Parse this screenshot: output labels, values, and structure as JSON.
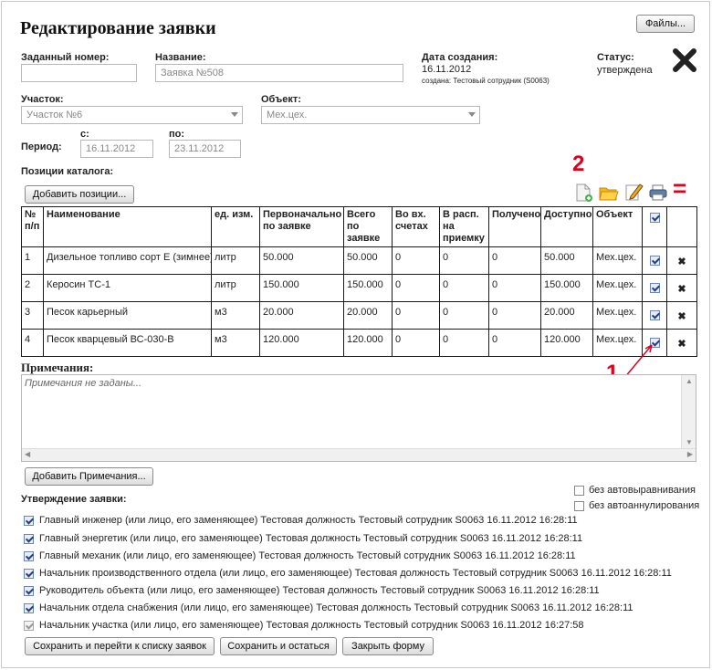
{
  "header": {
    "title": "Редактирование заявки",
    "files_button": "Файлы..."
  },
  "fields": {
    "number_label": "Заданный номер:",
    "number_value": "",
    "name_label": "Название:",
    "name_value": "Заявка №508",
    "created_label": "Дата создания:",
    "created_date": "16.11.2012",
    "created_by": "создана: Тестовый сотрудник (S0063)",
    "status_label": "Статус:",
    "status_value": "утверждена",
    "section_label": "Участок:",
    "section_value": "Участок №6",
    "object_label": "Объект:",
    "object_value": "Мех.цех.",
    "period_label": "Период:",
    "from_label": "с:",
    "from_value": "16.11.2012",
    "to_label": "по:",
    "to_value": "23.11.2012"
  },
  "catalog": {
    "label": "Позиции каталога:",
    "add_button": "Добавить позиции...",
    "toolbar_icons": [
      "new-document-icon",
      "folder-icon",
      "edit-pencil-icon",
      "print-icon"
    ],
    "columns": [
      "№ п/п",
      "Наименование",
      "ед. изм.",
      "Первоначально по заявке",
      "Всего по заявке",
      "Во вх. счетах",
      "В расп. на приемку",
      "Получено",
      "Доступно",
      "Объект"
    ],
    "rows": [
      {
        "n": "1",
        "name": "Дизельное топливо сорт Е (зимнее)",
        "unit": "литр",
        "initial": "50.000",
        "total": "50.000",
        "invoices": "0",
        "receipt": "0",
        "received": "0",
        "available": "50.000",
        "object": "Мех.цех."
      },
      {
        "n": "2",
        "name": "Керосин ТС-1",
        "unit": "литр",
        "initial": "150.000",
        "total": "150.000",
        "invoices": "0",
        "receipt": "0",
        "received": "0",
        "available": "150.000",
        "object": "Мех.цех."
      },
      {
        "n": "3",
        "name": "Песок карьерный",
        "unit": "м3",
        "initial": "20.000",
        "total": "20.000",
        "invoices": "0",
        "receipt": "0",
        "received": "0",
        "available": "20.000",
        "object": "Мех.цех."
      },
      {
        "n": "4",
        "name": "Песок кварцевый ВС-030-В",
        "unit": "м3",
        "initial": "120.000",
        "total": "120.000",
        "invoices": "0",
        "receipt": "0",
        "received": "0",
        "available": "120.000",
        "object": "Мех.цех."
      }
    ]
  },
  "notes": {
    "label": "Примечания:",
    "placeholder": "Примечания не заданы...",
    "add_button": "Добавить Примечания..."
  },
  "approval": {
    "label": "Утверждение заявки:",
    "no_autoalign": "без автовыравнивания",
    "no_autocancel": "без автоаннулирования",
    "entries": [
      "Главный инженер (или лицо, его заменяющее) Тестовая должность Тестовый сотрудник S0063 16.11.2012 16:28:11",
      "Главный энергетик (или лицо, его заменяющее) Тестовая должность Тестовый сотрудник S0063 16.11.2012 16:28:11",
      "Главный механик (или лицо, его заменяющее) Тестовая должность Тестовый сотрудник S0063 16.11.2012 16:28:11",
      "Начальник производственного отдела (или лицо, его заменяющее) Тестовая должность Тестовый сотрудник S0063 16.11.2012 16:28:11",
      "Руководитель объекта (или лицо, его заменяющее) Тестовая должность Тестовый сотрудник S0063 16.11.2012 16:28:11",
      "Начальник отдела снабжения (или лицо, его заменяющее) Тестовая должность Тестовый сотрудник S0063 16.11.2012 16:28:11",
      "Начальник участка (или лицо, его заменяющее) Тестовая должность Тестовый сотрудник S0063 16.11.2012 16:27:58"
    ]
  },
  "footer": {
    "save_go_button": "Сохранить и перейти к списку заявок",
    "save_stay_button": "Сохранить и остаться",
    "close_button": "Закрыть форму"
  },
  "annotations": {
    "marker_1": "1",
    "marker_2": "2",
    "marker_eq": "="
  },
  "colors": {
    "annotation_red": "#e0001b",
    "checkbox_blue": "#6d84b4"
  }
}
